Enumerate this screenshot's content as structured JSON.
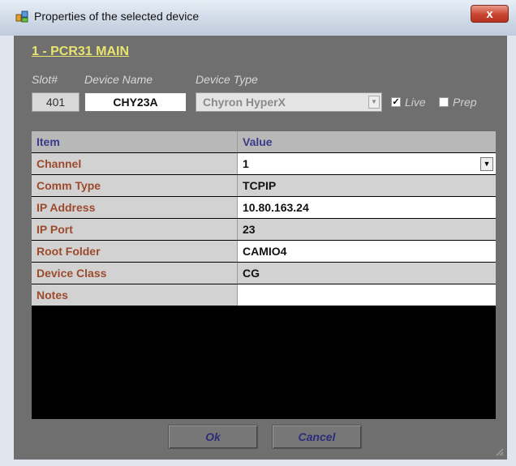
{
  "window": {
    "title": "Properties of the selected device",
    "close_glyph": "x"
  },
  "rack": {
    "title": "1 - PCR31  MAIN"
  },
  "headers": {
    "slot": "Slot#",
    "device_name": "Device Name",
    "device_type": "Device Type"
  },
  "device": {
    "slot": "401",
    "name": "CHY23A",
    "type": "Chyron HyperX"
  },
  "options": {
    "live_label": "Live",
    "live_checked": true,
    "prep_label": "Prep",
    "prep_checked": false
  },
  "grid": {
    "header": {
      "item": "Item",
      "value": "Value"
    },
    "rows": [
      {
        "item": "Channel",
        "value": "1",
        "editable": true,
        "dropdown": true
      },
      {
        "item": "Comm Type",
        "value": "TCPIP",
        "editable": false
      },
      {
        "item": "IP Address",
        "value": "10.80.163.24",
        "editable": true
      },
      {
        "item": "IP Port",
        "value": "23",
        "editable": false
      },
      {
        "item": "Root Folder",
        "value": "CAMIO4",
        "editable": true
      },
      {
        "item": "Device Class",
        "value": "CG",
        "editable": false
      },
      {
        "item": "Notes",
        "value": "",
        "editable": true
      }
    ]
  },
  "buttons": {
    "ok": "Ok",
    "cancel": "Cancel"
  },
  "colors": {
    "accent_title": "#e9e36f",
    "item_text": "#9c4a2c",
    "header_text": "#3a3a8a",
    "panel": "#6f6f6f"
  },
  "icons": {
    "window": "app-properties-icon",
    "close": "close-icon",
    "dropdown": "chevron-down-icon",
    "check": "checkmark-icon",
    "grip": "resize-grip-icon"
  }
}
